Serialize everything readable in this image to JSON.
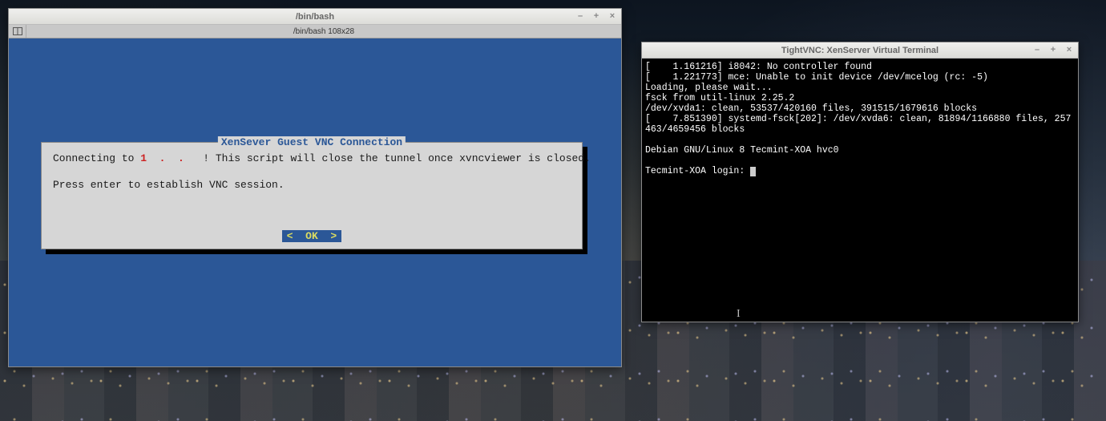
{
  "bash_window": {
    "title": "/bin/bash",
    "tab_label": "/bin/bash 108x28",
    "dialog": {
      "title": "XenSever Guest VNC Connection",
      "line1_prefix": "Connecting to ",
      "ip": "1  .  .   ",
      "line1_suffix": "! This script will close the tunnel once xvncviewer is closed.",
      "line2": "Press enter to establish VNC session.",
      "ok_label": "<  OK  >"
    },
    "buttons": {
      "minimize": "–",
      "maximize": "+",
      "close": "×"
    }
  },
  "vnc_window": {
    "title": "TightVNC: XenServer Virtual Terminal",
    "buttons": {
      "minimize": "–",
      "maximize": "+",
      "close": "×"
    },
    "console_lines": [
      "[    1.161216] i8042: No controller found",
      "[    1.221773] mce: Unable to init device /dev/mcelog (rc: -5)",
      "Loading, please wait...",
      "fsck from util-linux 2.25.2",
      "/dev/xvda1: clean, 53537/420160 files, 391515/1679616 blocks",
      "[    7.851390] systemd-fsck[202]: /dev/xvda6: clean, 81894/1166880 files, 257463/4659456 blocks",
      "",
      "Debian GNU/Linux 8 Tecmint-XOA hvc0",
      "",
      "Tecmint-XOA login: "
    ]
  }
}
